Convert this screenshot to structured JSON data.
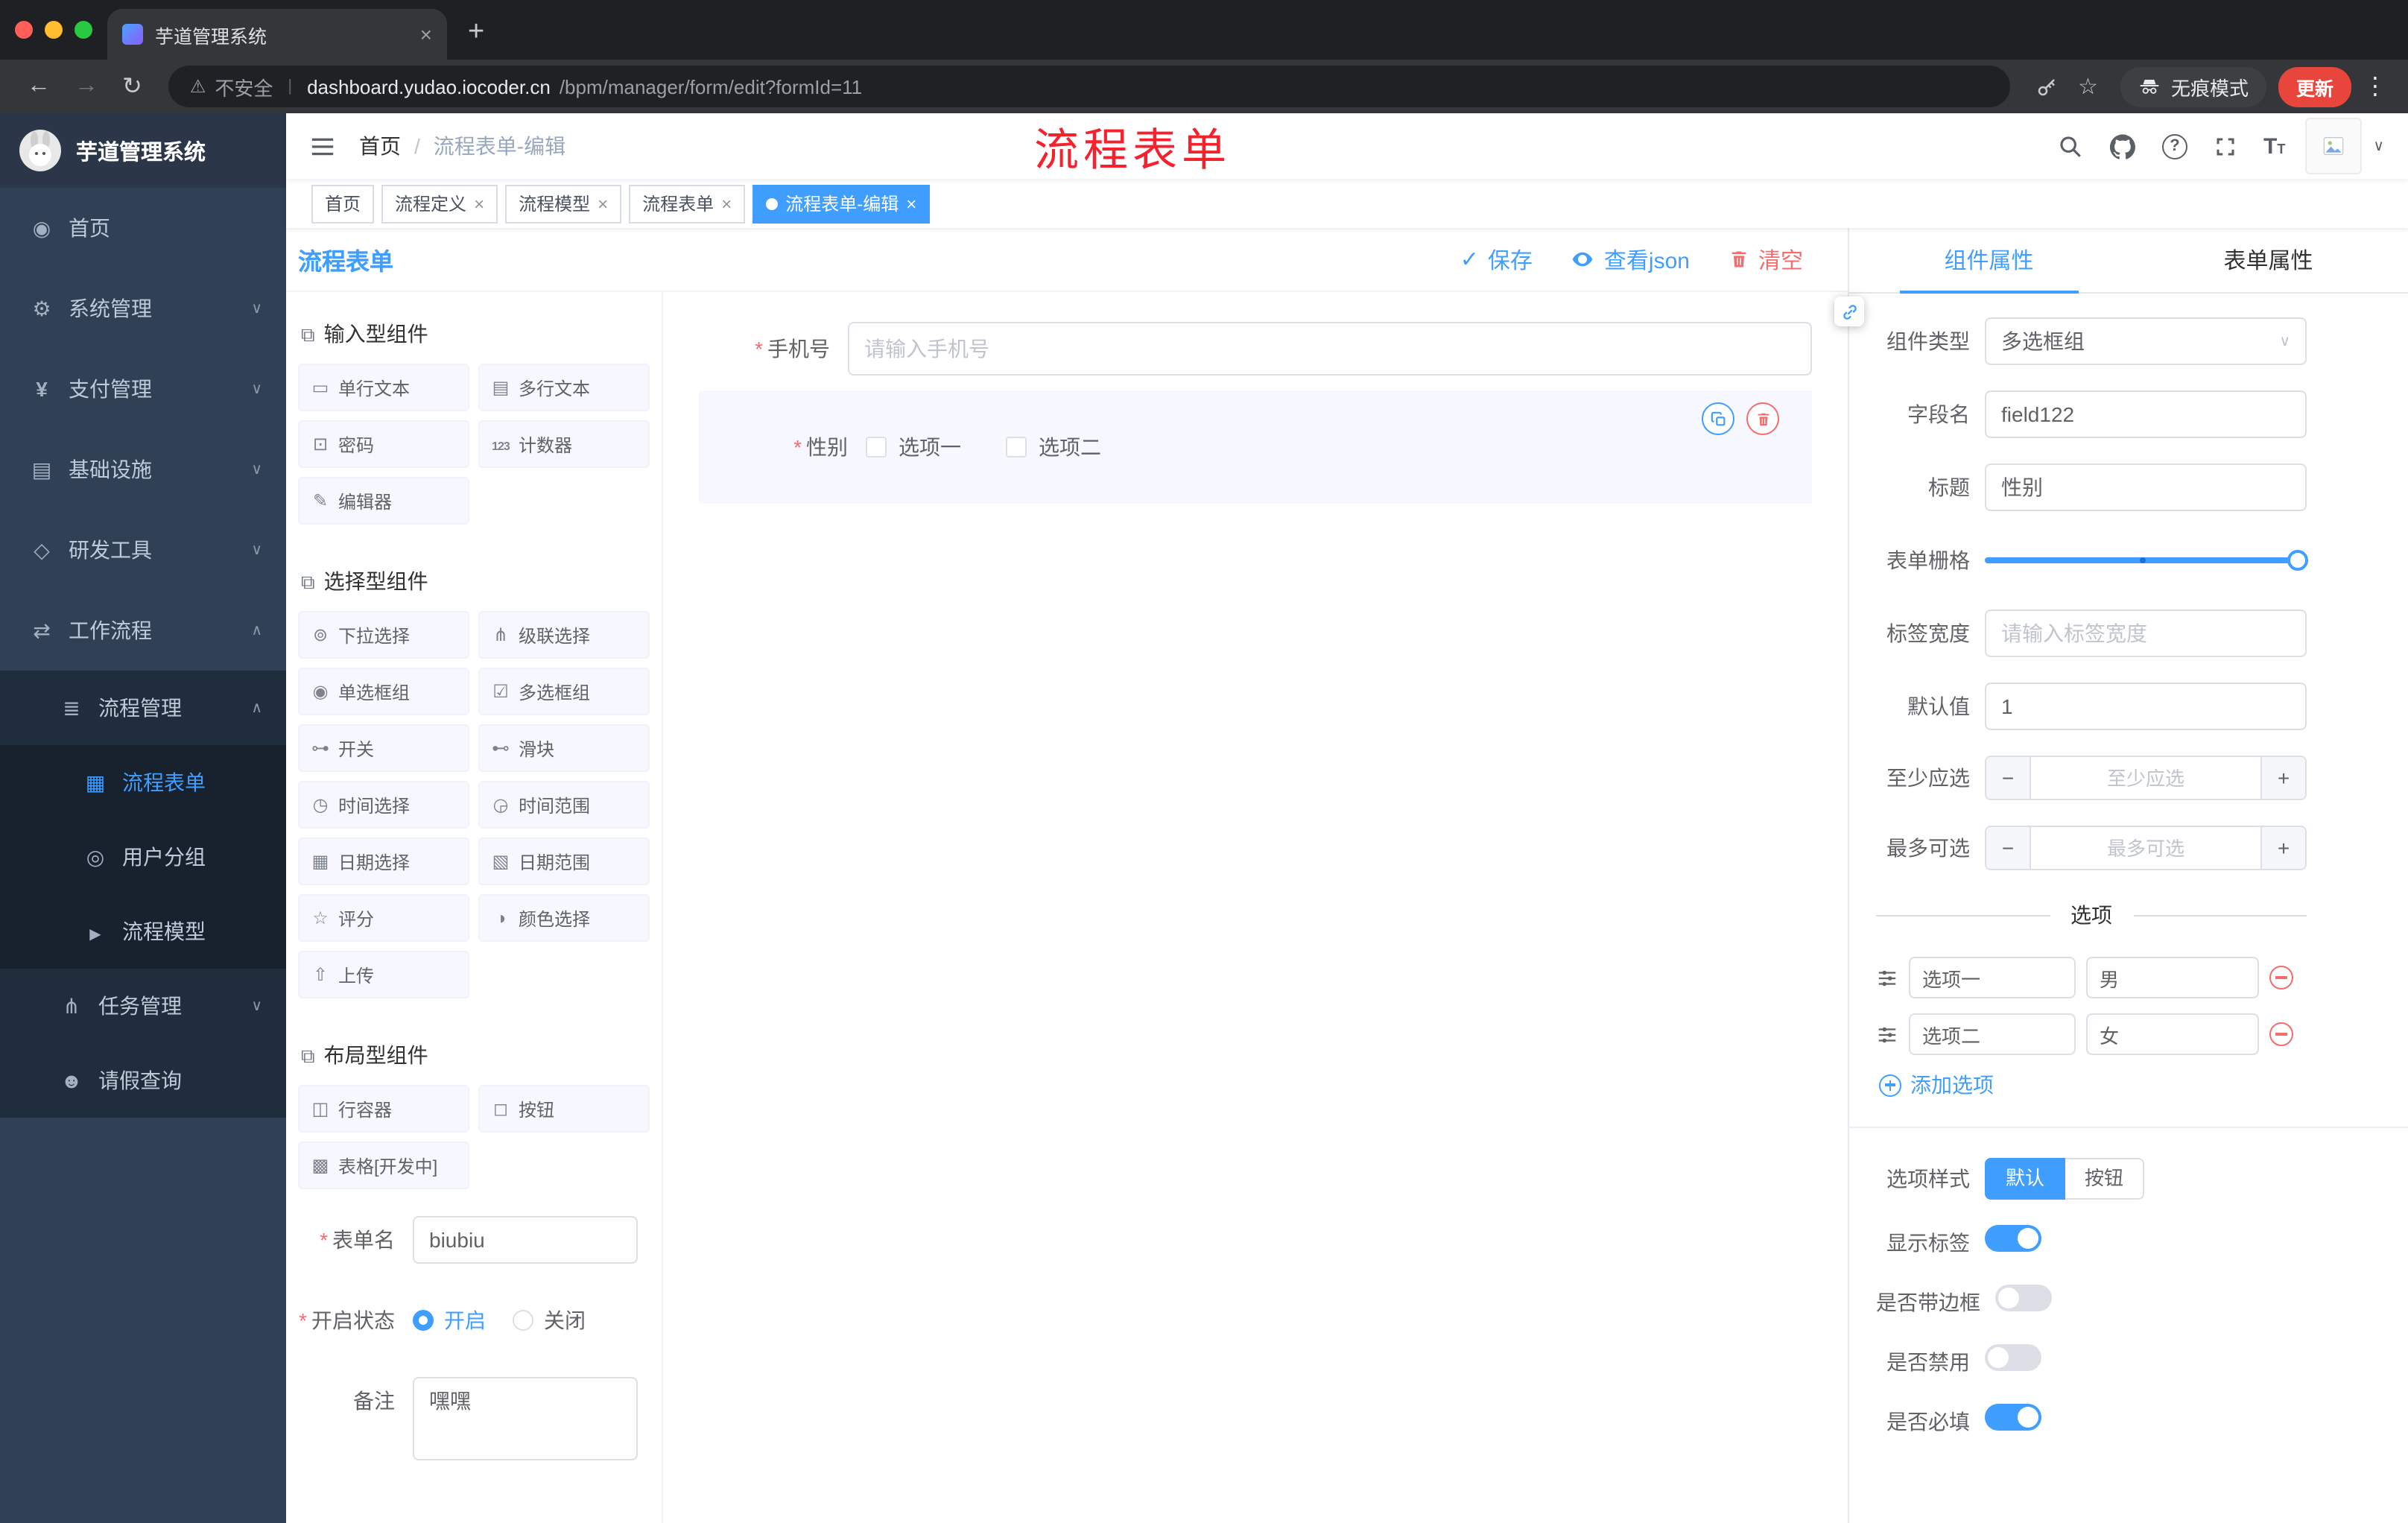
{
  "colors": {
    "primary": "#409EFF",
    "danger": "#F56C6C",
    "annotation_red": "#F5222D",
    "sidebar_bg": "#304156",
    "submenu_bg": "#1F2D3D",
    "tag_active_bg": "#409EFF",
    "selected_item_bg": "#F6F7FF"
  },
  "browser": {
    "tab": {
      "title": "芋道管理系统",
      "favicon": "yudao-favicon",
      "close_icon": "close-icon"
    },
    "new_tab_icon": "plus-icon",
    "nav": {
      "back": "back-arrow-icon",
      "forward": "forward-arrow-icon",
      "reload": "re​load-icon"
    },
    "omnibox": {
      "warning_icon": "warning-icon",
      "security_label": "不安全",
      "url_domain": "dashboard.yudao.iocoder.cn",
      "url_path": "/bpm/manager/form/edit?formId=11"
    },
    "right": {
      "key_icon": "key-icon",
      "star_icon": "star-icon",
      "incognito_icon": "incognito-icon",
      "incognito_label": "无痕模式",
      "update_label": "更新",
      "menu_icon": "kebab-menu-icon"
    }
  },
  "sidebar": {
    "logo_title": "芋道管理系统",
    "items": [
      {
        "label": "首页",
        "level": 1,
        "icon": "dashboard-icon"
      },
      {
        "label": "系统管理",
        "level": 1,
        "icon": "system-icon",
        "chevron": "down"
      },
      {
        "label": "支付管理",
        "level": 1,
        "icon": "payment-icon",
        "chevron": "down"
      },
      {
        "label": "基础设施",
        "level": 1,
        "icon": "infra-icon",
        "chevron": "down"
      },
      {
        "label": "研发工具",
        "level": 1,
        "icon": "devtools-icon",
        "chevron": "down"
      },
      {
        "label": "工作流程",
        "level": 1,
        "icon": "workflow-icon",
        "chevron": "up"
      },
      {
        "label": "流程管理",
        "level": 2,
        "icon": "process-mgmt-icon",
        "chevron": "up"
      },
      {
        "label": "流程表单",
        "level": 3,
        "icon": "process-form-icon",
        "active": true
      },
      {
        "label": "用户分组",
        "level": 3,
        "icon": "user-group-icon"
      },
      {
        "label": "流程模型",
        "level": 3,
        "icon": "process-model-icon"
      },
      {
        "label": "任务管理",
        "level": 2,
        "icon": "task-mgmt-icon",
        "chevron": "down"
      },
      {
        "label": "请假查询",
        "level": 2,
        "icon": "leave-query-icon"
      }
    ]
  },
  "navbar": {
    "hamburger_icon": "hamburger-icon",
    "breadcrumb_home": "首页",
    "breadcrumb_sep": "/",
    "breadcrumb_current": "流程表单-编辑",
    "annotation": "流程表单",
    "tools": [
      "search-icon",
      "github-icon",
      "help-icon",
      "fullscreen-icon",
      "font-size-icon",
      "avatar",
      "chevron-down-icon"
    ]
  },
  "tags": [
    {
      "label": "首页",
      "closable": false,
      "active": false
    },
    {
      "label": "流程定义",
      "closable": true,
      "active": false
    },
    {
      "label": "流程模型",
      "closable": true,
      "active": false
    },
    {
      "label": "流程表单",
      "closable": true,
      "active": false
    },
    {
      "label": "流程表单-编辑",
      "closable": true,
      "active": true
    }
  ],
  "designer": {
    "title": "流程表单",
    "actions": {
      "save": "保存",
      "view_json": "查看json",
      "clear": "清空"
    },
    "groups": [
      {
        "title": "输入型组件",
        "items": [
          {
            "label": "单行文本",
            "icon": "input-field-icon"
          },
          {
            "label": "多行文本",
            "icon": "textarea-icon"
          },
          {
            "label": "密码",
            "icon": "password-lock-icon"
          },
          {
            "label": "计数器",
            "icon": "counter-icon"
          },
          {
            "label": "编辑器",
            "icon": "editor-icon"
          }
        ]
      },
      {
        "title": "选择型组件",
        "items": [
          {
            "label": "下拉选择",
            "icon": "select-dropdown-icon"
          },
          {
            "label": "级联选择",
            "icon": "cascader-icon"
          },
          {
            "label": "单选框组",
            "icon": "radio-group-icon"
          },
          {
            "label": "多选框组",
            "icon": "checkbox-group-icon"
          },
          {
            "label": "开关",
            "icon": "switch-icon"
          },
          {
            "label": "滑块",
            "icon": "slider-icon"
          },
          {
            "label": "时间选择",
            "icon": "time-picker-icon"
          },
          {
            "label": "时间范围",
            "icon": "time-range-icon"
          },
          {
            "label": "日期选择",
            "icon": "date-picker-icon"
          },
          {
            "label": "日期范围",
            "icon": "date-range-icon"
          },
          {
            "label": "评分",
            "icon": "rate-star-icon"
          },
          {
            "label": "颜色选择",
            "icon": "color-picker-icon"
          },
          {
            "label": "上传",
            "icon": "upload-icon"
          }
        ]
      },
      {
        "title": "布局型组件",
        "items": [
          {
            "label": "行容器",
            "icon": "row-container-icon"
          },
          {
            "label": "按钮",
            "icon": "button-icon"
          },
          {
            "label": "表格[开发中]",
            "icon": "table-icon"
          }
        ]
      }
    ],
    "meta": {
      "name_label": "表单名",
      "name_value": "biubiu",
      "status_label": "开启状态",
      "status_on": "开启",
      "status_off": "关闭",
      "remark_label": "备注",
      "remark_value": "嘿嘿"
    },
    "canvas": {
      "phone": {
        "label": "手机号",
        "required": true,
        "placeholder": "请输入手机号"
      },
      "gender": {
        "label": "性别",
        "required": true,
        "options": [
          "选项一",
          "选项二"
        ],
        "actions": [
          "copy-icon",
          "trash-icon"
        ]
      }
    }
  },
  "props": {
    "tabs": [
      "组件属性",
      "表单属性"
    ],
    "component_type": {
      "label": "组件类型",
      "value": "多选框组"
    },
    "field_name": {
      "label": "字段名",
      "value": "field122"
    },
    "title": {
      "label": "标题",
      "value": "性别"
    },
    "grid": {
      "label": "表单栅格"
    },
    "label_width": {
      "label": "标签宽度",
      "placeholder": "请输入标签宽度"
    },
    "default_value": {
      "label": "默认值",
      "value": "1"
    },
    "min_select": {
      "label": "至少应选",
      "placeholder": "至少应选"
    },
    "max_select": {
      "label": "最多可选",
      "placeholder": "最多可选"
    },
    "options_divider": "选项",
    "options": [
      {
        "label": "选项一",
        "value": "男"
      },
      {
        "label": "选项二",
        "value": "女"
      }
    ],
    "add_option": "添加选项",
    "option_style": {
      "label": "选项样式",
      "choices": [
        "默认",
        "按钮"
      ],
      "selected": "默认"
    },
    "switches": [
      {
        "label": "显示标签",
        "state": "on"
      },
      {
        "label": "是否带边框",
        "state": "off"
      },
      {
        "label": "是否禁用",
        "state": "off"
      },
      {
        "label": "是否必填",
        "state": "on"
      }
    ]
  }
}
